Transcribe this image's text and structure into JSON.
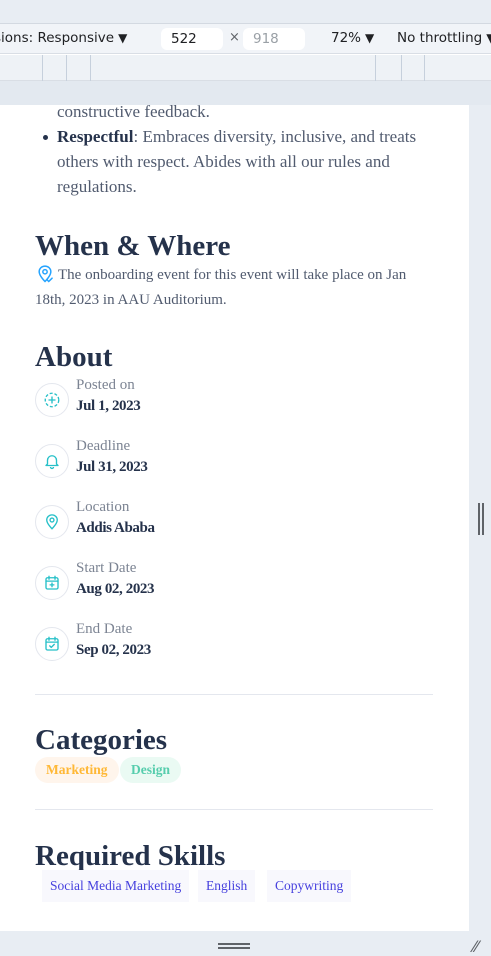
{
  "devtools": {
    "dimensions_label": "sions: Responsive",
    "width_value": "522",
    "height_placeholder": "918",
    "times": "×",
    "zoom": "72%",
    "throttling": "No throttling",
    "dropdown_arrow": "▼",
    "corner_grip": "⁄⁄"
  },
  "page": {
    "bullets": {
      "line0": "constructive feedback.",
      "item_title": "Respectful",
      "item_text": ": Embraces diversity, inclusive, and treats others with respect. Abides with all our rules and regulations."
    },
    "when_where": {
      "heading": "When & Where",
      "text": "The onboarding event for this event will take place on Jan 18th, 2023 in AAU Auditorium."
    },
    "about": {
      "heading": "About",
      "items": [
        {
          "label": "Posted on",
          "value": "Jul 1, 2023",
          "icon": "plus-circle-icon"
        },
        {
          "label": "Deadline",
          "value": "Jul 31, 2023",
          "icon": "bell-icon"
        },
        {
          "label": "Location",
          "value": "Addis Ababa",
          "icon": "location-pin-icon"
        },
        {
          "label": "Start Date",
          "value": "Aug 02, 2023",
          "icon": "calendar-plus-icon"
        },
        {
          "label": "End Date",
          "value": "Sep 02, 2023",
          "icon": "calendar-check-icon"
        }
      ]
    },
    "categories": {
      "heading": "Categories",
      "items": [
        "Marketing",
        "Design"
      ]
    },
    "skills": {
      "heading": "Required Skills",
      "items": [
        "Social Media Marketing",
        "English",
        "Copywriting"
      ]
    }
  },
  "colors": {
    "accent": "#26a4ff",
    "teal": "#26c0c8",
    "heading": "#25324b",
    "marketing_bg": "#fff5ec",
    "marketing_text": "#ffb836",
    "design_bg": "#eafaf3",
    "design_text": "#56cdad",
    "skill_text": "#4640de"
  }
}
